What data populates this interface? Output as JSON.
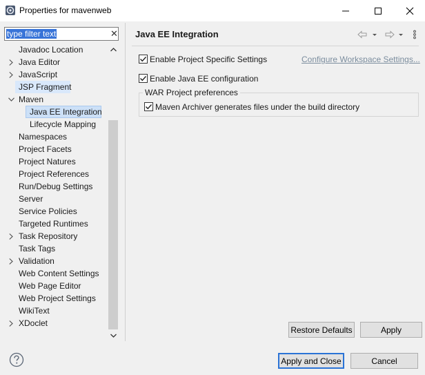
{
  "window": {
    "title": "Properties for mavenweb"
  },
  "filter": {
    "value": "type filter text"
  },
  "tree": [
    {
      "label": "Javadoc Location",
      "depth": 1,
      "expandable": false
    },
    {
      "label": "Java Editor",
      "depth": 1,
      "expandable": true
    },
    {
      "label": "JavaScript",
      "depth": 1,
      "expandable": true
    },
    {
      "label": "JSP Fragment",
      "depth": 1,
      "expandable": false
    },
    {
      "label": "Maven",
      "depth": 1,
      "expandable": true,
      "expanded": true
    },
    {
      "label": "Java EE Integration",
      "depth": 2,
      "expandable": false,
      "selected": true
    },
    {
      "label": "Lifecycle Mapping",
      "depth": 2,
      "expandable": false
    },
    {
      "label": "Namespaces",
      "depth": 1,
      "expandable": false
    },
    {
      "label": "Project Facets",
      "depth": 1,
      "expandable": false
    },
    {
      "label": "Project Natures",
      "depth": 1,
      "expandable": false
    },
    {
      "label": "Project References",
      "depth": 1,
      "expandable": false
    },
    {
      "label": "Run/Debug Settings",
      "depth": 1,
      "expandable": false
    },
    {
      "label": "Server",
      "depth": 1,
      "expandable": false
    },
    {
      "label": "Service Policies",
      "depth": 1,
      "expandable": false
    },
    {
      "label": "Targeted Runtimes",
      "depth": 1,
      "expandable": false
    },
    {
      "label": "Task Repository",
      "depth": 1,
      "expandable": true
    },
    {
      "label": "Task Tags",
      "depth": 1,
      "expandable": false
    },
    {
      "label": "Validation",
      "depth": 1,
      "expandable": true
    },
    {
      "label": "Web Content Settings",
      "depth": 1,
      "expandable": false
    },
    {
      "label": "Web Page Editor",
      "depth": 1,
      "expandable": false
    },
    {
      "label": "Web Project Settings",
      "depth": 1,
      "expandable": false
    },
    {
      "label": "WikiText",
      "depth": 1,
      "expandable": false
    },
    {
      "label": "XDoclet",
      "depth": 1,
      "expandable": true
    }
  ],
  "page": {
    "title": "Java EE Integration",
    "enable_specific_label": "Enable Project Specific Settings",
    "enable_specific_checked": true,
    "configure_link": "Configure Workspace Settings...",
    "enable_javaee_label": "Enable Java EE configuration",
    "enable_javaee_checked": true,
    "war_group_label": "WAR Project preferences",
    "maven_archiver_label": "Maven Archiver generates files under the build directory",
    "maven_archiver_checked": true
  },
  "buttons": {
    "restore_defaults": "Restore Defaults",
    "apply": "Apply",
    "apply_and_close": "Apply and Close",
    "cancel": "Cancel"
  },
  "icons": {
    "app": "properties-icon",
    "help": "help-icon",
    "back": "back-arrow-icon",
    "forward": "forward-arrow-icon",
    "menu": "view-menu-icon"
  }
}
